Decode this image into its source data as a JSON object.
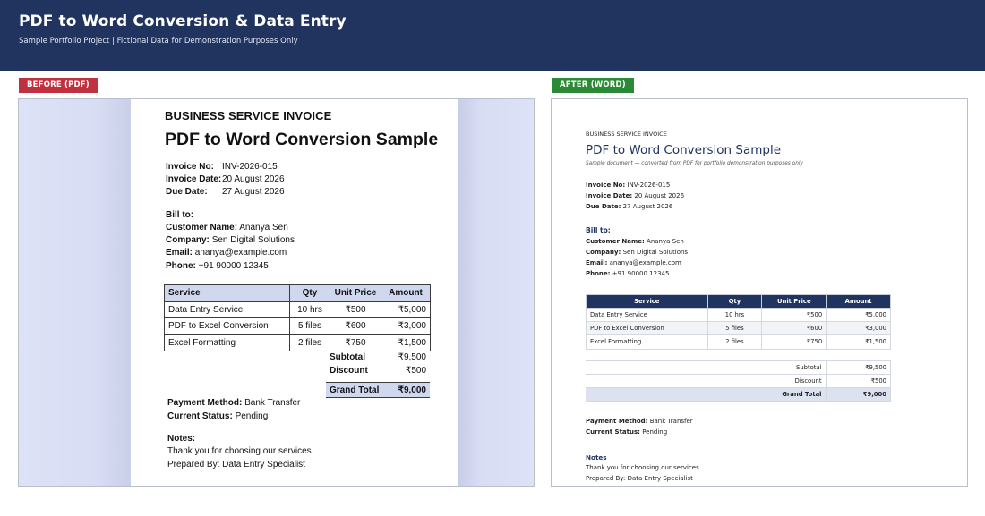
{
  "header": {
    "title": "PDF to Word Conversion & Data Entry",
    "subtitle": "Sample Portfolio Project  |  Fictional Data for Demonstration Purposes Only"
  },
  "badges": {
    "before": "BEFORE (PDF)",
    "after": "AFTER (WORD)"
  },
  "colors": {
    "header_bg": "#20345f",
    "before_badge": "#c0303e",
    "after_badge": "#2b8a36",
    "word_accent": "#1f3463"
  },
  "pdf": {
    "kicker": "BUSINESS SERVICE INVOICE",
    "title": "PDF to Word Conversion Sample",
    "invoice_no_label": "Invoice No:",
    "invoice_no": "INV-2026-015",
    "invoice_date_label": "Invoice Date:",
    "invoice_date": "20 August 2026",
    "due_date_label": "Due Date:",
    "due_date": "27 August 2026",
    "bill_to": "Bill to:",
    "customer_label": "Customer Name:",
    "customer": "Ananya Sen",
    "company_label": "Company:",
    "company": "Sen Digital Solutions",
    "email_label": "Email:",
    "email": "ananya@example.com",
    "phone_label": "Phone:",
    "phone": "+91 90000 12345",
    "table": {
      "headers": [
        "Service",
        "Qty",
        "Unit Price",
        "Amount"
      ],
      "rows": [
        [
          "Data Entry Service",
          "10 hrs",
          "₹500",
          "₹5,000"
        ],
        [
          "PDF to Excel Conversion",
          "5 files",
          "₹600",
          "₹3,000"
        ],
        [
          "Excel Formatting",
          "2 files",
          "₹750",
          "₹1,500"
        ]
      ]
    },
    "subtotal_label": "Subtotal",
    "subtotal": "₹9,500",
    "discount_label": "Discount",
    "discount": "₹500",
    "grand_total_label": "Grand Total",
    "grand_total": "₹9,000",
    "payment_label": "Payment Method:",
    "payment": "Bank Transfer",
    "status_label": "Current Status:",
    "status": "Pending",
    "notes_label": "Notes:",
    "notes_line1": "Thank you for choosing our services.",
    "notes_line2": "Prepared By: Data Entry Specialist"
  },
  "word": {
    "kicker": "BUSINESS SERVICE INVOICE",
    "title": "PDF to Word Conversion Sample",
    "note": "Sample document — converted from PDF for portfolio demonstration purposes only",
    "invoice_no_label": "Invoice No:",
    "invoice_no": "INV-2026-015",
    "invoice_date_label": "Invoice Date:",
    "invoice_date": "20 August 2026",
    "due_date_label": "Due Date:",
    "due_date": "27 August 2026",
    "bill_to": "Bill to:",
    "customer_label": "Customer Name:",
    "customer": "Ananya Sen",
    "company_label": "Company:",
    "company": "Sen Digital Solutions",
    "email_label": "Email:",
    "email": "ananya@example.com",
    "phone_label": "Phone:",
    "phone": "+91 90000 12345",
    "table": {
      "headers": [
        "Service",
        "Qty",
        "Unit Price",
        "Amount"
      ],
      "rows": [
        [
          "Data Entry Service",
          "10 hrs",
          "₹500",
          "₹5,000"
        ],
        [
          "PDF to Excel Conversion",
          "5 files",
          "₹600",
          "₹3,000"
        ],
        [
          "Excel Formatting",
          "2 files",
          "₹750",
          "₹1,500"
        ]
      ]
    },
    "subtotal_label": "Subtotal",
    "subtotal": "₹9,500",
    "discount_label": "Discount",
    "discount": "₹500",
    "grand_total_label": "Grand Total",
    "grand_total": "₹9,000",
    "payment_label": "Payment Method:",
    "payment": "Bank Transfer",
    "status_label": "Current Status:",
    "status": "Pending",
    "notes_label": "Notes",
    "notes_line1": "Thank you for choosing our services.",
    "notes_line2": "Prepared By: Data Entry Specialist"
  }
}
